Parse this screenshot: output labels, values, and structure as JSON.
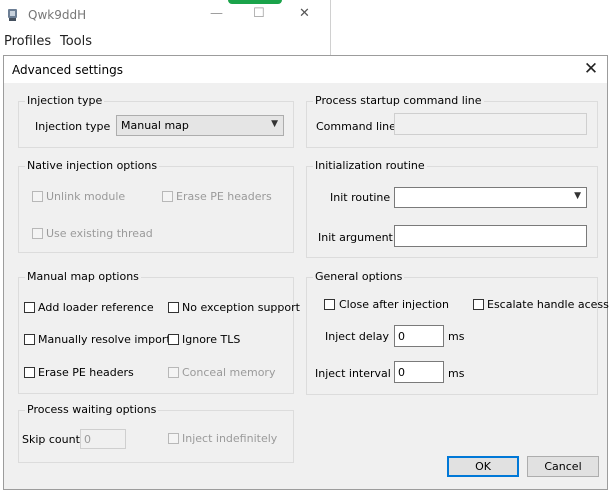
{
  "background_window": {
    "title": "Qwk9ddH",
    "menu": [
      "Profiles",
      "Tools"
    ],
    "controls": {
      "minimize": "—",
      "maximize": "☐",
      "close": "✕"
    }
  },
  "dialog": {
    "title": "Advanced settings",
    "close": "✕",
    "injection_type": {
      "group": "Injection type",
      "label": "Injection type",
      "value": "Manual map"
    },
    "process_startup": {
      "group": "Process startup command line",
      "label": "Command line",
      "value": ""
    },
    "native_injection": {
      "group": "Native injection options",
      "unlink_module": "Unlink module",
      "erase_pe_headers": "Erase PE headers",
      "use_existing_thread": "Use existing thread"
    },
    "init_routine": {
      "group": "Initialization routine",
      "routine_label": "Init routine",
      "routine_value": "",
      "argument_label": "Init argument",
      "argument_value": ""
    },
    "manual_map": {
      "group": "Manual map options",
      "add_loader_reference": "Add loader reference",
      "no_exception_support": "No exception support",
      "manually_resolve_imports": "Manually resolve imports",
      "ignore_tls": "Ignore TLS",
      "erase_pe_headers": "Erase PE headers",
      "conceal_memory": "Conceal memory"
    },
    "general": {
      "group": "General options",
      "close_after_injection": "Close after injection",
      "escalate_handle": "Escalate handle acess",
      "inject_delay_label": "Inject delay",
      "inject_delay_value": "0",
      "inject_delay_unit": "ms",
      "inject_interval_label": "Inject interval",
      "inject_interval_value": "0",
      "inject_interval_unit": "ms"
    },
    "process_waiting": {
      "group": "Process waiting options",
      "skip_count_label": "Skip count",
      "skip_count_value": "0",
      "inject_indefinitely": "Inject indefinitely"
    },
    "buttons": {
      "ok": "OK",
      "cancel": "Cancel"
    }
  }
}
